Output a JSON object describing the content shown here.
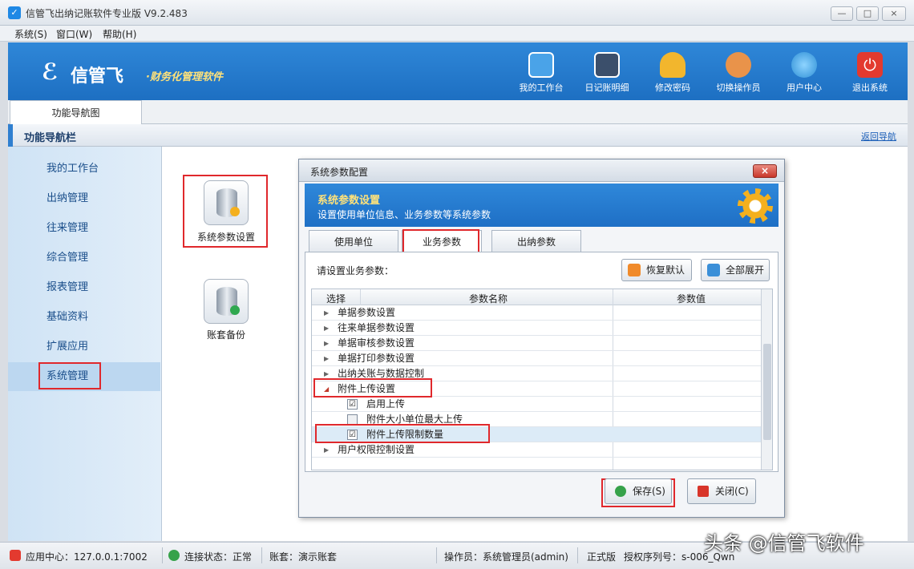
{
  "window": {
    "title": "信管飞出纳记账软件专业版 V9.2.483",
    "app_icon": "app-logo-icon"
  },
  "menu": [
    "系统(S)",
    "窗口(W)",
    "帮助(H)"
  ],
  "header": {
    "logo_text": "信管飞",
    "logo_sub": "·财务化管理软件",
    "toolbar": [
      {
        "label": "我的工作台",
        "icon": "monitor-icon",
        "color": "#4aa3e8"
      },
      {
        "label": "日记账明细",
        "icon": "list-icon",
        "color": "#3b4f6b"
      },
      {
        "label": "修改密码",
        "icon": "lock-icon",
        "color": "#f2b62d"
      },
      {
        "label": "切换操作员",
        "icon": "user-icon",
        "color": "#e9934a"
      },
      {
        "label": "用户中心",
        "icon": "globe-icon",
        "color": "#3fb34f"
      },
      {
        "label": "退出系统",
        "icon": "power-icon",
        "color": "#e33a2f"
      }
    ]
  },
  "tabs": {
    "nav_tab": "功能导航图"
  },
  "navbar": {
    "title": "功能导航栏",
    "return_link": "返回导航"
  },
  "sidebar": {
    "items": [
      "我的工作台",
      "出纳管理",
      "往来管理",
      "综合管理",
      "报表管理",
      "基础资料",
      "扩展应用",
      "系统管理"
    ],
    "active_index": 7
  },
  "content": {
    "icons": [
      {
        "label": "系统参数设置",
        "icon": "database-settings-icon"
      },
      {
        "label": "账套备份",
        "icon": "database-backup-icon"
      }
    ]
  },
  "dialog": {
    "title": "系统参数配置",
    "close_label": "×",
    "banner_title": "系统参数设置",
    "banner_subtitle": "设置使用单位信息、业务参数等系统参数",
    "tabs": [
      "使用单位",
      "业务参数",
      "出纳参数"
    ],
    "active_tab": 1,
    "hint": "请设置业务参数：",
    "restore_btn": "恢复默认",
    "expand_btn": "全部展开",
    "grid_headers": [
      "选择",
      "参数名称",
      "参数值"
    ],
    "rows": [
      {
        "type": "group",
        "caret": "▶",
        "label": "单据参数设置"
      },
      {
        "type": "group",
        "caret": "▶",
        "label": "往来单据参数设置"
      },
      {
        "type": "group",
        "caret": "▶",
        "label": "单据审核参数设置"
      },
      {
        "type": "group",
        "caret": "▶",
        "label": "单据打印参数设置"
      },
      {
        "type": "group",
        "caret": "▶",
        "label": "出纳关账与数据控制"
      },
      {
        "type": "group",
        "caret": "◢",
        "label": "附件上传设置"
      },
      {
        "type": "child",
        "checked": "☑",
        "label": "启用上传"
      },
      {
        "type": "child",
        "checked": "",
        "label": "附件大小单位最大上传"
      },
      {
        "type": "child",
        "checked": "☑",
        "label": "附件上传限制数量"
      },
      {
        "type": "group",
        "caret": "▶",
        "label": "用户权限控制设置"
      }
    ],
    "selected_row": 8,
    "save_btn": "保存(S)",
    "close_btn": "关闭(C)"
  },
  "status": {
    "center": "应用中心：127.0.0.1:7002",
    "link": "连接状态：正常",
    "account": "账套：演示账套",
    "operator": "操作员：系统管理员(admin)",
    "version": "正式版",
    "serial": "授权序列号：s-006_Qwn"
  },
  "watermark": "头条 @信管飞软件"
}
